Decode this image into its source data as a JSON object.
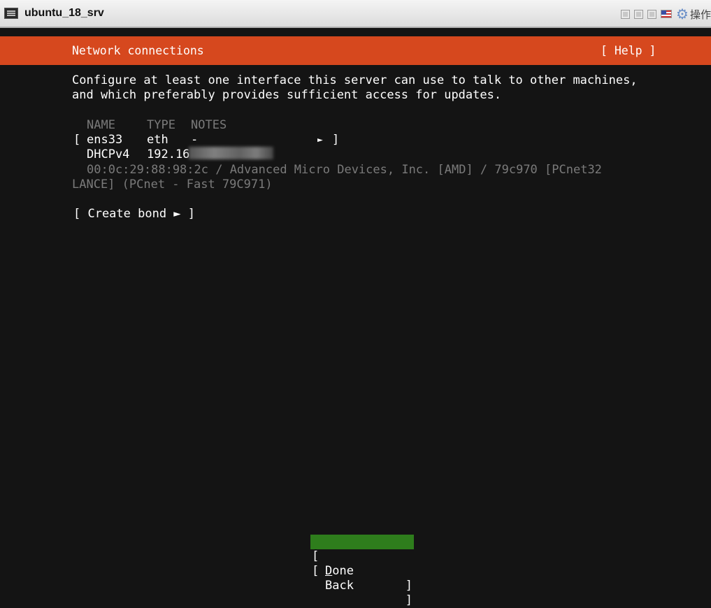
{
  "window": {
    "title": "ubuntu_18_srv",
    "ops_label": "操作",
    "icons": [
      "console-icon",
      "minimize-icon",
      "restore-icon",
      "maximize-icon",
      "flag-icon",
      "gear-icon"
    ]
  },
  "header": {
    "title": "Network connections",
    "help": "[ Help ]"
  },
  "intro": {
    "line1": "Configure at least one interface this server can use to talk to other machines,",
    "line2": "and which preferably provides sufficient access for updates."
  },
  "table": {
    "headers": [
      "NAME",
      "TYPE",
      "NOTES"
    ],
    "interface": {
      "open_bracket": "[",
      "name": "ens33",
      "type": "eth",
      "notes": "-",
      "arrow": "►",
      "close_bracket": "]",
      "dhcp_label": "DHCPv4",
      "dhcp_value": "192.16",
      "details_line1": "00:0c:29:88:98:2c / Advanced Micro Devices, Inc. [AMD] / 79c970 [PCnet32",
      "details_line2": "LANCE] (PCnet - Fast 79C971)"
    }
  },
  "create_bond": "[ Create bond ► ]",
  "buttons": {
    "done": {
      "first": "D",
      "rest": "one"
    },
    "back": "Back",
    "open": "[",
    "close": "]"
  },
  "colors": {
    "header_bg": "#d6481e",
    "selected_bg": "#2e7d1c",
    "background": "#141414"
  }
}
